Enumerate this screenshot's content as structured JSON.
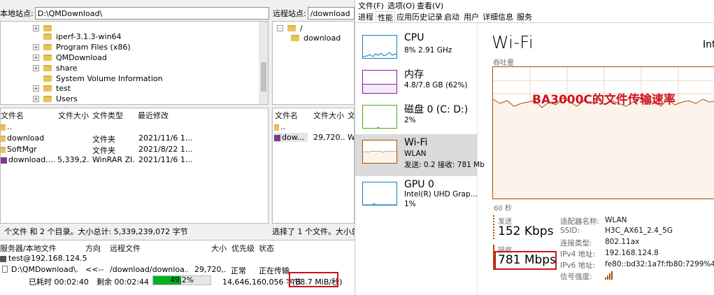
{
  "filezilla": {
    "local_site_label": "本地站点:",
    "local_path": "D:\\QMDownload\\",
    "remote_site_label": "远程站点:",
    "remote_path": "/download",
    "local_tree": [
      {
        "name": "iperf-3.1.3-win64"
      },
      {
        "name": "Program Files (x86)"
      },
      {
        "name": "QMDownload"
      },
      {
        "name": "share"
      },
      {
        "name": "System Volume Information"
      },
      {
        "name": "test"
      },
      {
        "name": "Users"
      }
    ],
    "remote_tree": [
      {
        "name": "/"
      },
      {
        "name": "download"
      }
    ],
    "local_columns": [
      "文件名",
      "文件大小",
      "文件类型",
      "最近修改"
    ],
    "local_files": [
      {
        "name": "..",
        "size": "",
        "type": "",
        "modified": ""
      },
      {
        "name": "download",
        "size": "",
        "type": "文件夹",
        "modified": "2021/11/6 1..."
      },
      {
        "name": "SoftMgr",
        "size": "",
        "type": "文件夹",
        "modified": "2021/8/22 1..."
      },
      {
        "name": "download....",
        "size": "5,339,2...",
        "type": "WinRAR ZI...",
        "modified": "2021/11/6 1..."
      }
    ],
    "remote_columns": [
      "文件名",
      "文件大小",
      "文"
    ],
    "remote_files": [
      {
        "name": "..",
        "size": "",
        "type": ""
      },
      {
        "name": "dow...",
        "size": "29,720...",
        "type": "W"
      }
    ],
    "local_status": "个文件 和 2 个目录。大小总计: 5,339,239,072 字节",
    "remote_status": "选择了 1 个文件。大小总计",
    "queue_columns": [
      "服务器/本地文件",
      "方向",
      "远程文件",
      "大小",
      "优先级",
      "状态"
    ],
    "queue": {
      "server": "test@192.168.124.5",
      "local_file": "D:\\QMDownload\\...",
      "direction": "<<--",
      "remote_file": "/download/downloa...",
      "size": "29,720,...",
      "priority": "正常",
      "state": "正在传输",
      "elapsed": "已耗时 00:02:40",
      "remaining": "剩余 00:02:44",
      "progress_text": "49.2%",
      "progress": 0.492,
      "bytes": "14,646,160,056 字节",
      "rate": "(88.7 MiB/秒)"
    }
  },
  "taskmgr": {
    "menu": [
      "文件(F)",
      "选项(O)",
      "查看(V)"
    ],
    "tabs": [
      "进程",
      "性能",
      "应用历史记录",
      "启动",
      "用户",
      "详细信息",
      "服务"
    ],
    "active_tab": "性能",
    "sidebar": [
      {
        "title": "CPU",
        "sub1": "8% 2.91 GHz",
        "sub2": "",
        "color": "#117dbb"
      },
      {
        "title": "内存",
        "sub1": "4.8/7.8 GB (62%)",
        "sub2": "",
        "color": "#8b12ae"
      },
      {
        "title": "磁盘 0 (C: D:)",
        "sub1": "2%",
        "sub2": "",
        "color": "#4da60c"
      },
      {
        "title": "Wi-Fi",
        "sub1": "WLAN",
        "sub2": "发送: 0.2 接收: 781 Mb",
        "color": "#a74f01"
      },
      {
        "title": "GPU 0",
        "sub1": "Intel(R) UHD Grap...",
        "sub2": "1%",
        "color": "#117dbb"
      }
    ],
    "main": {
      "title": "Wi-Fi",
      "adapter_head": "Int",
      "throughput_label": "吞吐量",
      "annotation": "BA3000C的文件传输速率",
      "time_label": "60 秒",
      "send_label": "发送",
      "send_value": "152 Kbps",
      "recv_label": "接收",
      "recv_value": "781 Mbps",
      "props": [
        {
          "k": "适配器名称:",
          "v": "WLAN"
        },
        {
          "k": "SSID:",
          "v": "H3C_AX61_2.4_5G"
        },
        {
          "k": "连接类型:",
          "v": "802.11ax"
        },
        {
          "k": "IPv4 地址:",
          "v": "192.168.124.8"
        },
        {
          "k": "IPv6 地址:",
          "v": "fe80::bd32:1a7f:fb80:7299%4"
        },
        {
          "k": "信号强度:",
          "v": ""
        }
      ]
    },
    "colors": {
      "wifi": "#a74f01",
      "wifi_fill": "#fcf3eb",
      "highlight": "#d0121b"
    }
  }
}
